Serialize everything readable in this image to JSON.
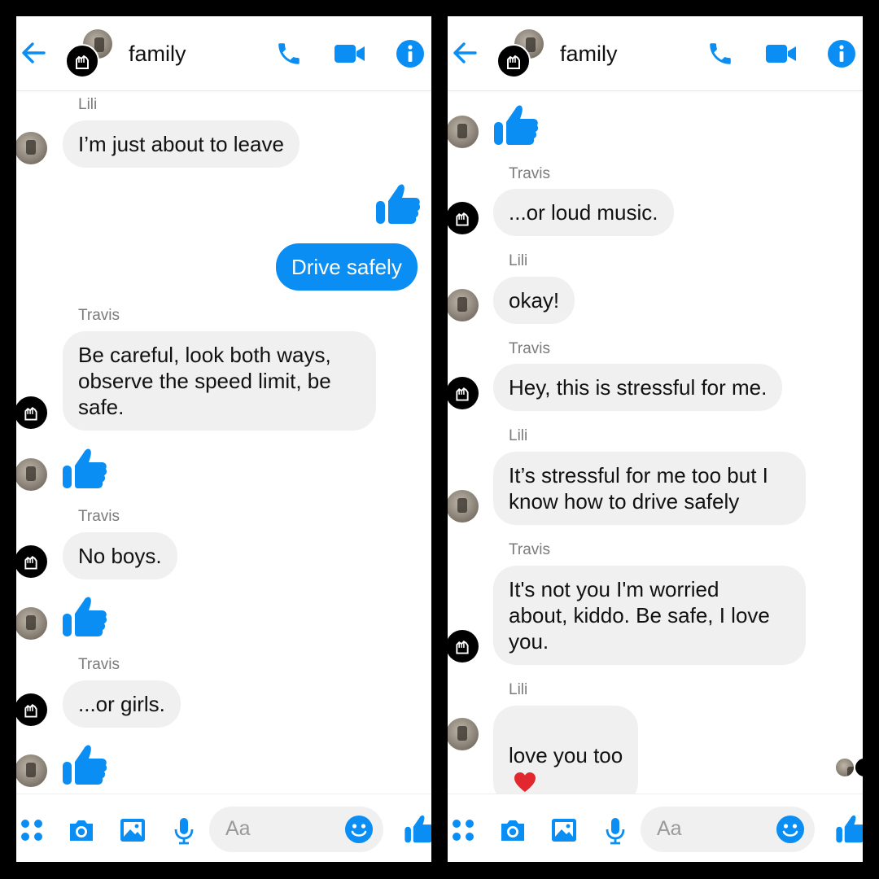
{
  "colors": {
    "accent": "#0a8ef3",
    "bubble_other": "#f0f0f0",
    "bubble_mine": "#0a8ef3",
    "heart": "#e0282e"
  },
  "left": {
    "header": {
      "title": "family"
    },
    "messages": [
      {
        "sender": "Lili"
      },
      {
        "text": "I’m just about to leave"
      },
      {
        "text": "Drive safely"
      },
      {
        "sender": "Travis"
      },
      {
        "text": "Be careful, look both ways,\nobserve the speed limit, be\nsafe."
      },
      {
        "sender": "Travis"
      },
      {
        "text": "No boys."
      },
      {
        "sender": "Travis"
      },
      {
        "text": "...or girls."
      }
    ],
    "composer": {
      "placeholder": "Aa"
    }
  },
  "right": {
    "header": {
      "title": "family"
    },
    "messages": [
      {
        "sender": "Travis"
      },
      {
        "text": "...or loud music."
      },
      {
        "sender": "Lili"
      },
      {
        "text": "okay!"
      },
      {
        "sender": "Travis"
      },
      {
        "text": "Hey, this is stressful for me."
      },
      {
        "sender": "Lili"
      },
      {
        "text": "It’s stressful for me too but I\nknow how to drive safely"
      },
      {
        "sender": "Travis"
      },
      {
        "text": "It's not you I'm worried\nabout, kiddo.  Be safe, I love\nyou."
      },
      {
        "sender": "Lili"
      },
      {
        "text": "love you too"
      }
    ],
    "composer": {
      "placeholder": "Aa"
    }
  },
  "icons": [
    "back-arrow-icon",
    "phone-icon",
    "video-camera-icon",
    "info-icon",
    "thumbs-up-icon",
    "menu-dots-icon",
    "camera-icon",
    "gallery-icon",
    "microphone-icon",
    "emoji-icon",
    "heart-icon"
  ]
}
